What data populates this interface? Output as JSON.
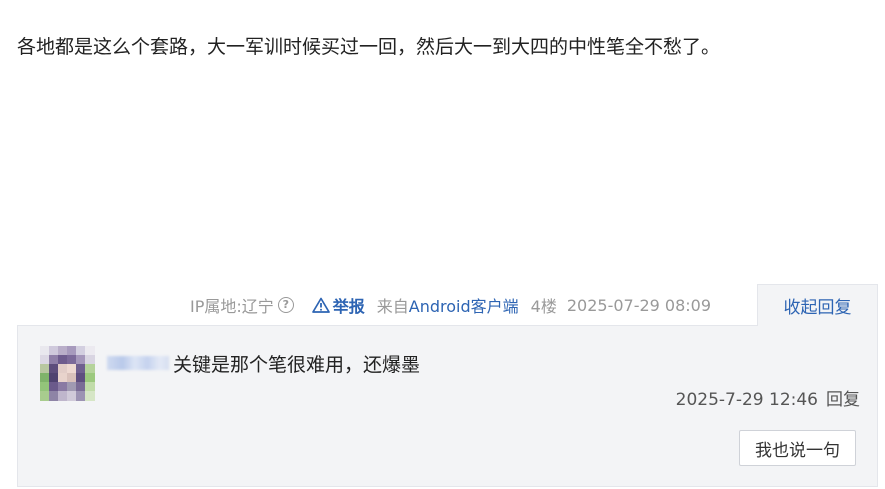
{
  "post": {
    "content": "各地都是这么个套路，大一军训时候买过一回，然后大一到大四的中性笔全不愁了。"
  },
  "tail": {
    "ip": "IP属地:辽宁",
    "help_icon_glyph": "?",
    "report_label": "举报",
    "from_prefix": "来自",
    "client": "Android客户端",
    "floor": "4楼",
    "time": "2025-07-29 08:09",
    "collapse_label": "收起回复"
  },
  "reply": {
    "username": "••••••",
    "text": "关键是那个笔很难用，还爆墨",
    "time": "2025-7-29 12:46",
    "reply_label": "回复"
  },
  "say_button_label": "我也说一句",
  "colors": {
    "link_blue": "#2d64b3",
    "meta_gray": "#999999",
    "reply_bg": "#f3f4f6",
    "border": "#e4e6eb"
  },
  "icons": {
    "help": "question-circle-icon",
    "report": "warning-triangle-icon"
  }
}
